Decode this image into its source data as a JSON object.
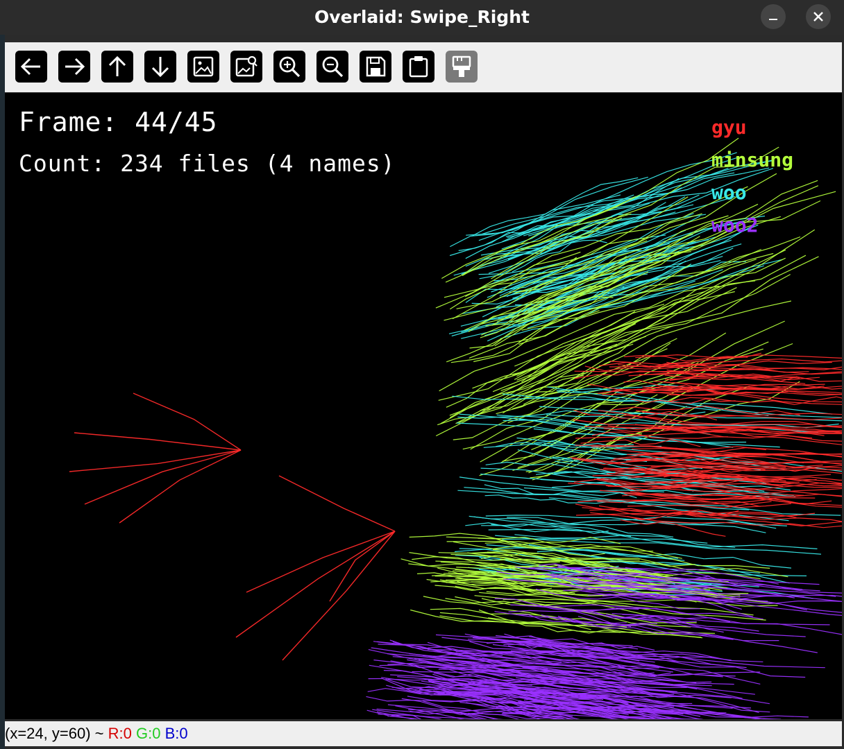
{
  "window": {
    "title": "Overlaid: Swipe_Right",
    "minimize_icon": "minimize-icon",
    "close_icon": "close-icon"
  },
  "toolbar": {
    "buttons": [
      {
        "name": "pan-left-button",
        "icon": "arrow-left-icon"
      },
      {
        "name": "pan-right-button",
        "icon": "arrow-right-icon"
      },
      {
        "name": "pan-up-button",
        "icon": "arrow-up-icon"
      },
      {
        "name": "pan-down-button",
        "icon": "arrow-down-icon"
      },
      {
        "name": "zoom-image-button",
        "icon": "image-icon"
      },
      {
        "name": "zoom-area-button",
        "icon": "image-search-icon"
      },
      {
        "name": "zoom-in-button",
        "icon": "zoom-in-icon"
      },
      {
        "name": "zoom-out-button",
        "icon": "zoom-out-icon"
      },
      {
        "name": "save-button",
        "icon": "save-icon"
      },
      {
        "name": "copy-clipboard-button",
        "icon": "clipboard-icon"
      },
      {
        "name": "properties-button",
        "icon": "paint-brush-icon",
        "disabled": true
      }
    ]
  },
  "canvas": {
    "frame_text": "Frame: 44/45",
    "count_text": "Count: 234 files (4 names)",
    "legend": [
      {
        "label": "gyu",
        "color": "#ff2a2a"
      },
      {
        "label": "minsung",
        "color": "#b4ff3c"
      },
      {
        "label": "woo",
        "color": "#38e8e8"
      },
      {
        "label": "woo2",
        "color": "#9a30ff"
      }
    ]
  },
  "status": {
    "coords": "(x=24, y=60) ~ ",
    "r": "R:0",
    "g": "G:0",
    "b": "B:0",
    "colors": {
      "r": "#d40000",
      "g": "#22cc22",
      "b": "#0000cc"
    }
  }
}
